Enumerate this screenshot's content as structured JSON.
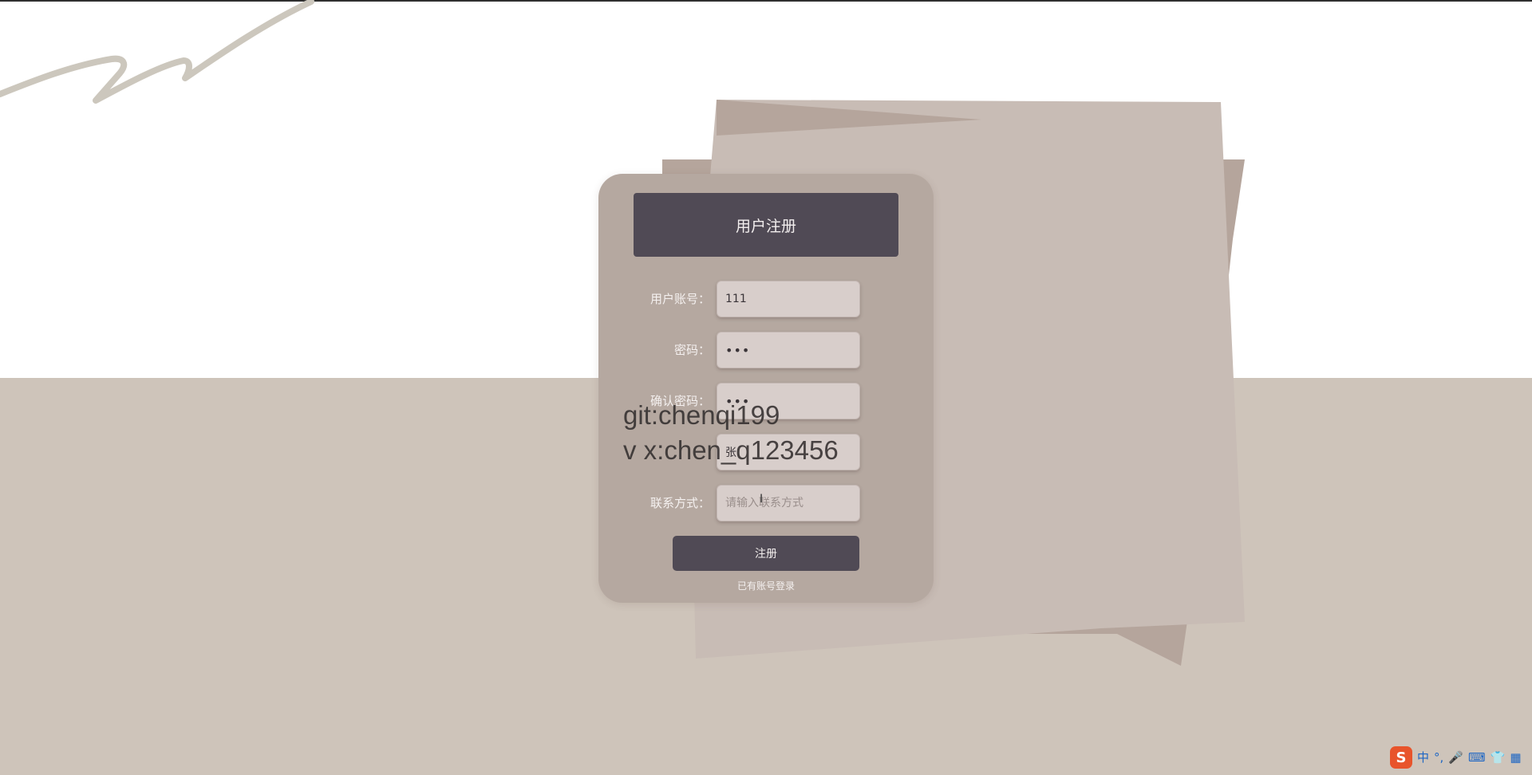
{
  "form": {
    "title": "用户注册",
    "fields": [
      {
        "label": "用户账号：",
        "value": "111",
        "placeholder": "",
        "type": "text"
      },
      {
        "label": "密码：",
        "value": "•••",
        "placeholder": "",
        "type": "password"
      },
      {
        "label": "确认密码：",
        "value": "•••",
        "placeholder": "",
        "type": "password"
      },
      {
        "label": "",
        "value": "张",
        "placeholder": "",
        "type": "text"
      },
      {
        "label": "联系方式：",
        "value": "",
        "placeholder": "请输入联系方式",
        "type": "text"
      }
    ],
    "submit_label": "注册",
    "login_link": "已有账号登录"
  },
  "watermark": {
    "line1": "git:chenqi199",
    "line2": "v x:chen_q123456"
  },
  "ime_toolbar": {
    "logo": "S",
    "items": [
      "中",
      "°,",
      "🎤",
      "⌨",
      "👕",
      "▦"
    ]
  },
  "colors": {
    "card_bg": "#b5a8a0",
    "header_bg": "#504a55",
    "button_bg": "#504a55",
    "input_bg": "#d8cecb",
    "floor": "#cec4ba",
    "paper": "#c8bcb5",
    "paper_dark": "#b5a59c"
  }
}
